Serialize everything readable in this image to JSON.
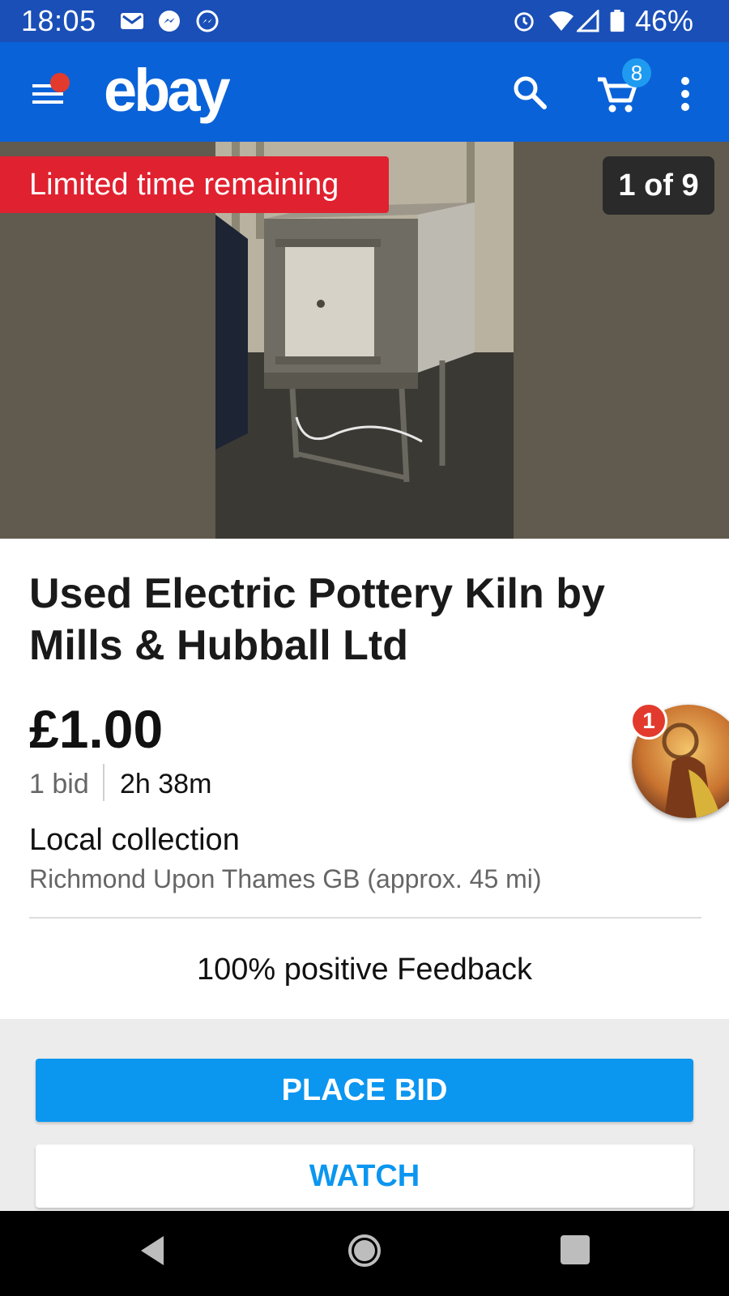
{
  "status_bar": {
    "time": "18:05",
    "battery": "46%"
  },
  "app_bar": {
    "logo": "ebay",
    "cart_count": "8"
  },
  "hero": {
    "banner": "Limited time remaining",
    "image_counter": "1 of 9"
  },
  "listing": {
    "title": "Used Electric Pottery Kiln by Mills & Hubball Ltd",
    "price": "£1.00",
    "bids": "1 bid",
    "time_left": "2h 38m",
    "delivery_heading": "Local collection",
    "delivery_location": "Richmond Upon Thames GB (approx. 45 mi)",
    "feedback": "100% positive Feedback"
  },
  "chat_head": {
    "badge": "1"
  },
  "actions": {
    "place_bid": "PLACE BID",
    "watch": "WATCH"
  },
  "colors": {
    "status_bar": "#1a4fb8",
    "app_bar": "#0a62d8",
    "primary_button": "#0b96f0",
    "banner_red": "#e0212f"
  }
}
